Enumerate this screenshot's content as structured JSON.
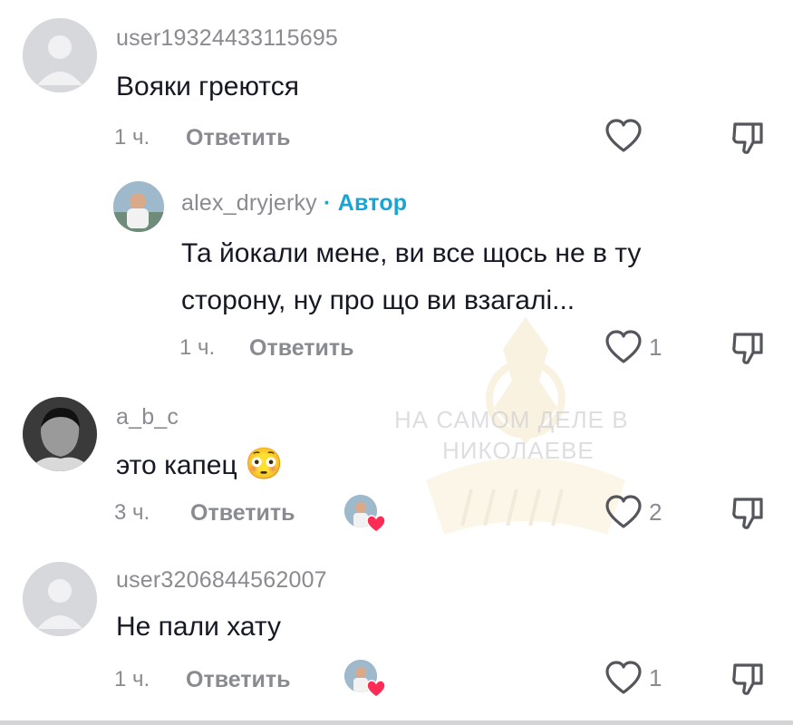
{
  "comments": [
    {
      "username": "user1932443311569​5",
      "text": "Вояки греются",
      "time": "1 ч.",
      "reply_label": "Ответить",
      "likes": ""
    },
    {
      "username": "alex_dryjerky",
      "author_badge": "· Автор",
      "text_line1": "Та йокали мене, ви все щось не в ту",
      "text_line2": "сторону, ну про що ви взагалі...",
      "time": "1 ч.",
      "reply_label": "Ответить",
      "likes": "1"
    },
    {
      "username": "a_b_c",
      "text": "это капец",
      "emoji": "😳",
      "time": "3 ч.",
      "reply_label": "Ответить",
      "likes": "2"
    },
    {
      "username": "user3206844562007",
      "text": "Не пали хату",
      "time": "1 ч.",
      "reply_label": "Ответить",
      "likes": "1"
    }
  ],
  "watermark": {
    "line1": "НА САМОМ ДЕЛЕ В",
    "line2": "НИКОЛАЕВЕ"
  },
  "colors": {
    "text": "#161823",
    "muted": "#8a8b91",
    "author_badge": "#19a4d6",
    "heart": "#fe2c55"
  },
  "icons": [
    "heart-outline-icon",
    "dislike-icon",
    "creator-liked-heart-icon"
  ]
}
